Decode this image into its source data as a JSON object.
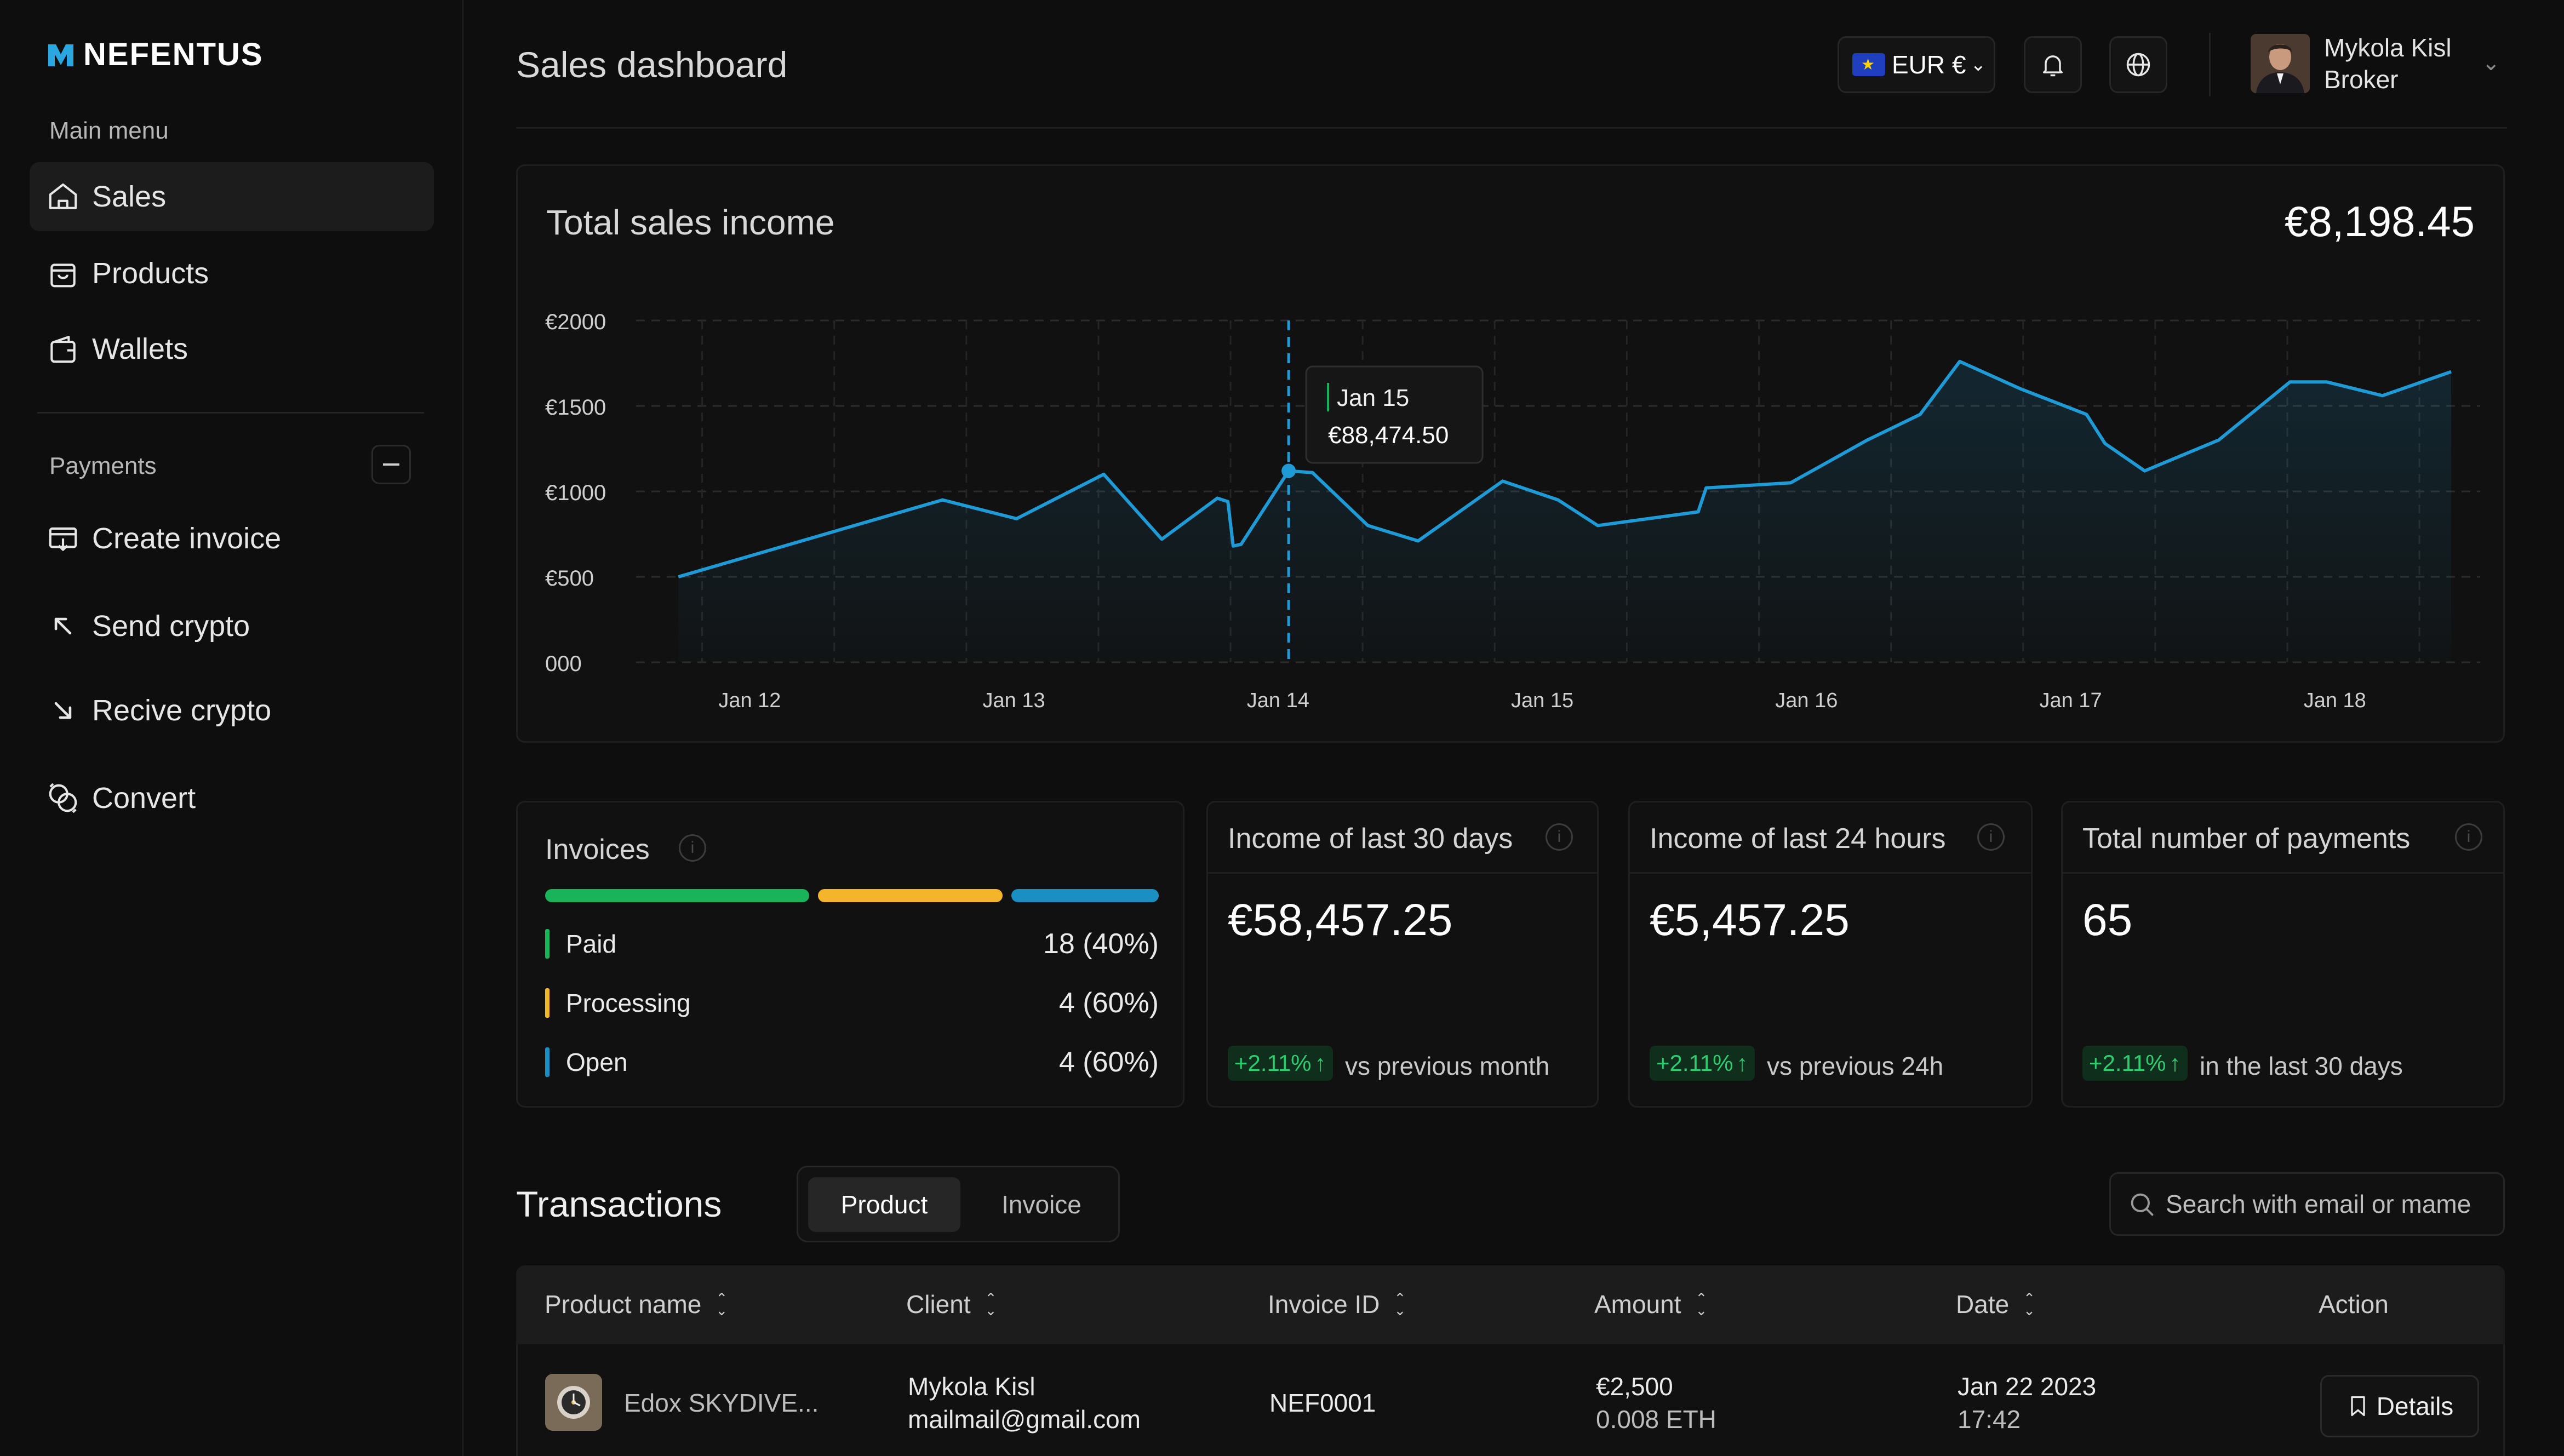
{
  "app": {
    "name": "NEFENTUS"
  },
  "sidebar": {
    "main_menu_title": "Main menu",
    "main_items": [
      {
        "label": "Sales",
        "icon": "home-icon",
        "active": true
      },
      {
        "label": "Products",
        "icon": "shopping-bag-icon",
        "active": false
      },
      {
        "label": "Wallets",
        "icon": "wallet-icon",
        "active": false
      }
    ],
    "payments_title": "Payments",
    "payment_items": [
      {
        "label": "Create invoice",
        "icon": "invoice-icon"
      },
      {
        "label": "Send crypto",
        "icon": "arrow-up-left-icon"
      },
      {
        "label": "Recive crypto",
        "icon": "arrow-down-right-icon"
      },
      {
        "label": "Convert",
        "icon": "convert-icon"
      }
    ]
  },
  "header": {
    "title": "Sales dashboard",
    "currency": "EUR €",
    "user_name": "Mykola Kisl",
    "user_role": "Broker"
  },
  "chart": {
    "title": "Total sales income",
    "total": "€8,198.45",
    "tooltip_date": "Jan 15",
    "tooltip_value": "€88,474.50"
  },
  "chart_data": {
    "type": "area",
    "title": "Total sales income",
    "y_tick_labels": [
      "000",
      "€500",
      "€1000",
      "€1500",
      "€2000"
    ],
    "ylim": [
      0,
      2000
    ],
    "x_tick_labels": [
      "Jan 12",
      "Jan 13",
      "Jan 14",
      "Jan 15",
      "Jan 16",
      "Jan 17",
      "Jan 18"
    ],
    "grid": true,
    "color": "#1e9bd7",
    "series": [
      {
        "x": [
          -0.27,
          0.73,
          1.01,
          1.34,
          1.56,
          1.77,
          1.81,
          1.83,
          1.86,
          2.04,
          2.13,
          2.34,
          2.53,
          2.85,
          3.06,
          3.21,
          3.59,
          3.62,
          3.94,
          4.23,
          4.43,
          4.58,
          4.81,
          5.06,
          5.13,
          5.28,
          5.56,
          5.83,
          5.97,
          6.18,
          6.44
        ],
        "values": [
          500,
          950,
          840,
          1100,
          720,
          960,
          940,
          680,
          690,
          1120,
          1110,
          800,
          710,
          1060,
          950,
          800,
          880,
          1020,
          1050,
          1300,
          1450,
          1760,
          1600,
          1450,
          1280,
          1120,
          1300,
          1640,
          1640,
          1560,
          1700
        ]
      }
    ],
    "highlight": {
      "label": "Jan 15",
      "value": "€88,474.50"
    }
  },
  "invoices": {
    "title": "Invoices",
    "distribution": [
      {
        "status": "Paid",
        "fraction": 0.43,
        "color": "#19b35a"
      },
      {
        "status": "Processing",
        "fraction": 0.3,
        "color": "#f5b52a"
      },
      {
        "status": "Open",
        "fraction": 0.24,
        "color": "#1a8fc3"
      }
    ],
    "rows": [
      {
        "label": "Paid",
        "value": "18  (40%)",
        "color": "#19b35a"
      },
      {
        "label": "Processing",
        "value": "4  (60%)",
        "color": "#f5b52a"
      },
      {
        "label": "Open",
        "value": "4  (60%)",
        "color": "#1a8fc3"
      }
    ]
  },
  "stats": [
    {
      "title": "Income of last 30 days",
      "value": "€58,457.25",
      "badge": "+2.11%",
      "note": "vs previous month"
    },
    {
      "title": "Income of last 24 hours",
      "value": "€5,457.25",
      "badge": "+2.11%",
      "note": "vs previous 24h"
    },
    {
      "title": "Total number of payments",
      "value": "65",
      "badge": "+2.11%",
      "note": "in the last 30 days"
    }
  ],
  "transactions": {
    "title": "Transactions",
    "tabs": [
      "Product",
      "Invoice"
    ],
    "search_placeholder": "Search with email or mame",
    "columns": [
      "Product name",
      "Client",
      "Invoice ID",
      "Amount",
      "Date",
      "Action"
    ],
    "rows": [
      {
        "product": "Edox SKYDIVE...",
        "client_name": "Mykola Kisl",
        "client_email": "mailmail@gmail.com",
        "invoice_id": "NEF0001",
        "amount": "€2,500",
        "amount_crypto": "0.008 ETH",
        "date": "Jan 22 2023",
        "time": "17:42",
        "action": "Details"
      }
    ]
  }
}
